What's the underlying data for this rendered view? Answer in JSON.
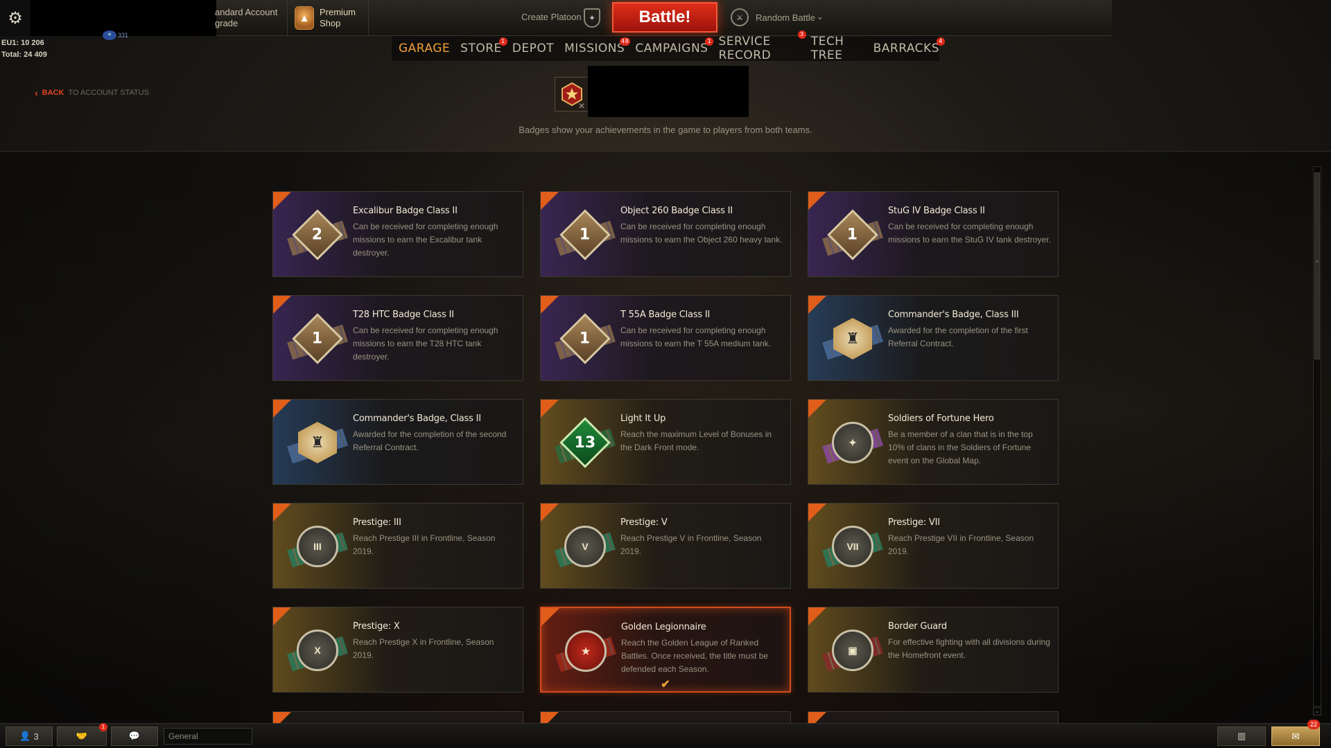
{
  "topbar": {
    "account_text_line1": "andard Account",
    "account_text_line2": "grade",
    "premium_label": "Premium Shop",
    "create_platoon": "Create Platoon",
    "battle_label": "Battle!",
    "mode_label": "Random Battle"
  },
  "stats": {
    "server": "EU1: 10 206",
    "total": "Total: 24 409",
    "xp_value": "331"
  },
  "nav": {
    "items": [
      {
        "label": "GARAGE",
        "active": true,
        "badge": ""
      },
      {
        "label": "STORE",
        "active": false,
        "badge": "1"
      },
      {
        "label": "DEPOT",
        "active": false,
        "badge": ""
      },
      {
        "label": "MISSIONS",
        "active": false,
        "badge": "48"
      },
      {
        "label": "CAMPAIGNS",
        "active": false,
        "badge": "1"
      },
      {
        "label": "SERVICE RECORD",
        "active": false,
        "badge": "3"
      },
      {
        "label": "TECH TREE",
        "active": false,
        "badge": ""
      },
      {
        "label": "BARRACKS",
        "active": false,
        "badge": "4"
      }
    ]
  },
  "back": {
    "label": "BACK",
    "target": "TO ACCOUNT STATUS"
  },
  "header": {
    "description": "Badges show your achievements in the game to players from both teams.",
    "close_glyph": "✕"
  },
  "badges": [
    {
      "title": "Excalibur Badge Class II",
      "description": "Can be received for completing enough missions to earn the Excalibur tank destroyer.",
      "style": "purple",
      "shape": "diamond",
      "symbol": "2",
      "ribbon": "#8a6b4a",
      "selected": false
    },
    {
      "title": "Object 260 Badge Class II",
      "description": "Can be received for completing enough missions to earn the Object 260 heavy tank.",
      "style": "purple",
      "shape": "diamond",
      "symbol": "1",
      "ribbon": "#8a6b4a",
      "selected": false
    },
    {
      "title": "StuG IV Badge Class II",
      "description": "Can be received for completing enough missions to earn the StuG IV tank destroyer.",
      "style": "purple",
      "shape": "diamond",
      "symbol": "1",
      "ribbon": "#8a6b4a",
      "selected": false
    },
    {
      "title": "T28 HTC Badge Class II",
      "description": "Can be received for completing enough missions to earn the T28 HTC tank destroyer.",
      "style": "purple",
      "shape": "diamond",
      "symbol": "1",
      "ribbon": "#8a6b4a",
      "selected": false
    },
    {
      "title": "T 55A Badge Class II",
      "description": "Can be received for completing enough missions to earn the T 55A medium tank.",
      "style": "purple",
      "shape": "diamond",
      "symbol": "1",
      "ribbon": "#8a6b4a",
      "selected": false
    },
    {
      "title": "Commander's Badge, Class III",
      "description": "Awarded for the completion of the first Referral Contract.",
      "style": "blue",
      "shape": "hex",
      "symbol": "♜",
      "ribbon": "#4a6a9a",
      "selected": false
    },
    {
      "title": "Commander's Badge, Class II",
      "description": "Awarded for the completion of the second Referral Contract.",
      "style": "blue",
      "shape": "hex",
      "symbol": "♜",
      "ribbon": "#4a6a9a",
      "selected": false
    },
    {
      "title": "Light It Up",
      "description": "Reach the maximum Level of Bonuses in the Dark Front mode.",
      "style": "gold",
      "shape": "diamond-green",
      "symbol": "13",
      "ribbon": "#2a6a3a",
      "selected": false
    },
    {
      "title": "Soldiers of Fortune Hero",
      "description": "Be a member of a clan that is in the top 10% of clans in the Soldiers of Fortune event on the Global Map.",
      "style": "gold",
      "shape": "round",
      "symbol": "✦",
      "ribbon": "#8a4aa0",
      "selected": false
    },
    {
      "title": "Prestige: III",
      "description": "Reach Prestige III in Frontline, Season 2019.",
      "style": "gold",
      "shape": "round",
      "symbol": "III",
      "ribbon": "#2a7a5a",
      "selected": false
    },
    {
      "title": "Prestige: V",
      "description": "Reach Prestige V in Frontline, Season 2019.",
      "style": "gold",
      "shape": "round",
      "symbol": "V",
      "ribbon": "#2a7a5a",
      "selected": false
    },
    {
      "title": "Prestige: VII",
      "description": "Reach Prestige VII in Frontline, Season 2019.",
      "style": "gold",
      "shape": "round",
      "symbol": "VII",
      "ribbon": "#2a7a5a",
      "selected": false
    },
    {
      "title": "Prestige: X",
      "description": "Reach Prestige X in Frontline, Season 2019.",
      "style": "gold",
      "shape": "round",
      "symbol": "X",
      "ribbon": "#2a7a5a",
      "selected": false
    },
    {
      "title": "Golden Legionnaire",
      "description": "Reach the Golden League of Ranked Battles. Once received, the title must be defended each Season.",
      "style": "red",
      "shape": "round",
      "symbol": "★",
      "ribbon": "#a02a1a",
      "selected": true
    },
    {
      "title": "Border Guard",
      "description": "For effective fighting with all divisions during the Homefront event.",
      "style": "gold",
      "shape": "round",
      "symbol": "▣",
      "ribbon": "#8a2a2a",
      "selected": false
    }
  ],
  "bottombar": {
    "players_count": "3",
    "friends_badge": "1",
    "chat_channel": "General",
    "notif_count": "22"
  },
  "colors": {
    "accent": "#f1a03c",
    "battle_red": "#e02e1a",
    "selected_border": "#d44c1c"
  }
}
